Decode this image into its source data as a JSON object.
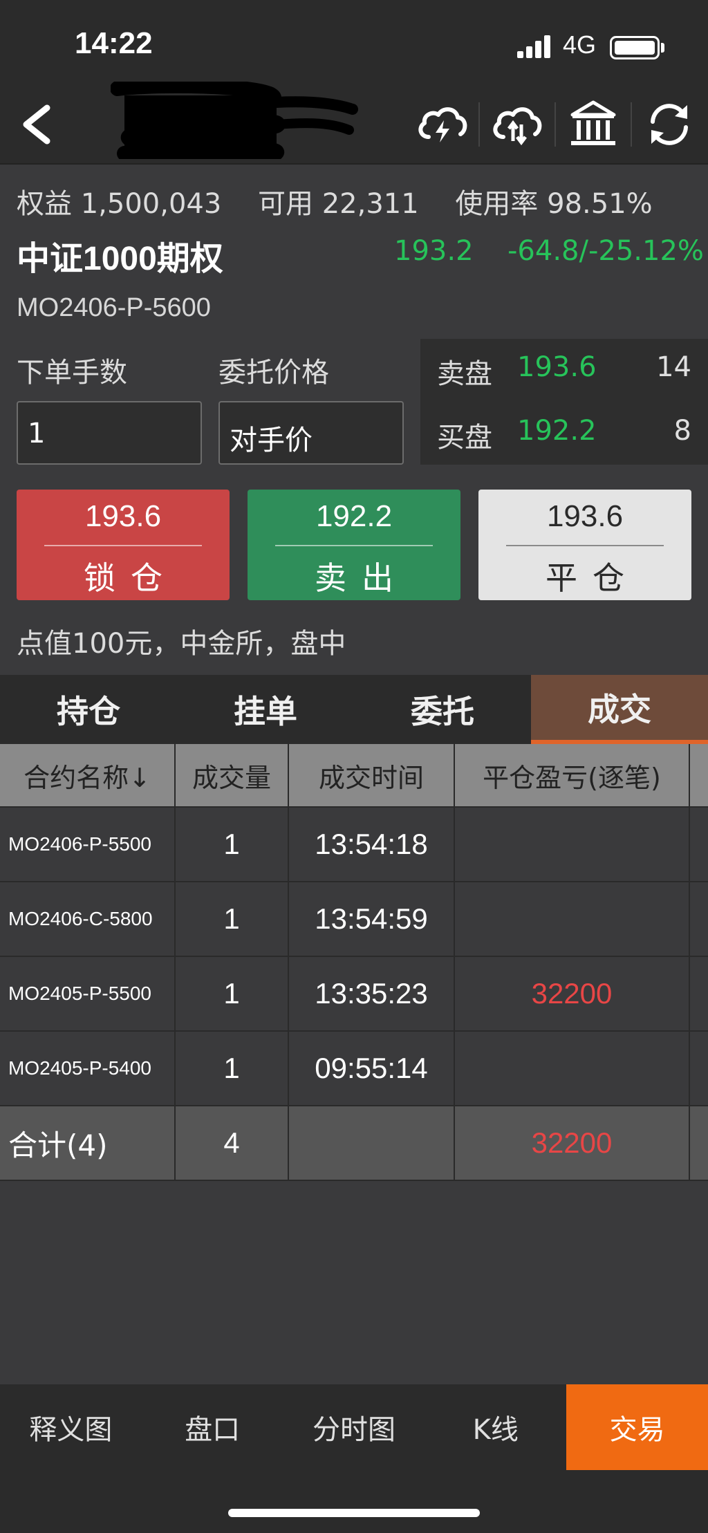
{
  "status_bar": {
    "time": "14:22",
    "network": "4G"
  },
  "header": {
    "icons": [
      "back-icon",
      "cloud-lightning-icon",
      "cloud-sync-icon",
      "bank-icon",
      "refresh-icon"
    ]
  },
  "account": {
    "equity_label": "权益",
    "equity_value": "1,500,043",
    "available_label": "可用",
    "available_value": "22,311",
    "usage_label": "使用率",
    "usage_value": "98.51%"
  },
  "contract": {
    "name": "中证1000期权",
    "last_price": "193.2",
    "change": "-64.8/-25.12%",
    "code": "MO2406-P-5600",
    "info": "点值100元，中金所，盘中"
  },
  "order_form": {
    "qty_label": "下单手数",
    "price_label": "委托价格",
    "qty_value": "1",
    "price_value": "对手价"
  },
  "orderbook": {
    "ask_label": "卖盘",
    "ask_price": "193.6",
    "ask_qty": "14",
    "bid_label": "买盘",
    "bid_price": "192.2",
    "bid_qty": "8"
  },
  "buttons": {
    "lock": {
      "price": "193.6",
      "label": "锁仓"
    },
    "sell": {
      "price": "192.2",
      "label": "卖出"
    },
    "close": {
      "price": "193.6",
      "label": "平仓"
    }
  },
  "tabs": [
    "持仓",
    "挂单",
    "委托",
    "成交"
  ],
  "active_tab": "成交",
  "table": {
    "headers": [
      "合约名称↓",
      "成交量",
      "成交时间",
      "平仓盈亏(逐笔)"
    ],
    "rows": [
      {
        "contract": "MO2406-P-5500",
        "volume": "1",
        "time": "13:54:18",
        "pnl": ""
      },
      {
        "contract": "MO2406-C-5800",
        "volume": "1",
        "time": "13:54:59",
        "pnl": ""
      },
      {
        "contract": "MO2405-P-5500",
        "volume": "1",
        "time": "13:35:23",
        "pnl": "32200"
      },
      {
        "contract": "MO2405-P-5400",
        "volume": "1",
        "time": "09:55:14",
        "pnl": ""
      }
    ],
    "total": {
      "label": "合计(4)",
      "volume": "4",
      "pnl": "32200"
    }
  },
  "bottom_nav": [
    "释义图",
    "盘口",
    "分时图",
    "K线",
    "交易"
  ],
  "active_bottom": "交易",
  "colors": {
    "up": "#e84646",
    "down": "#27c35a",
    "accent": "#f06a12",
    "tab_active": "#6e4b3a"
  }
}
